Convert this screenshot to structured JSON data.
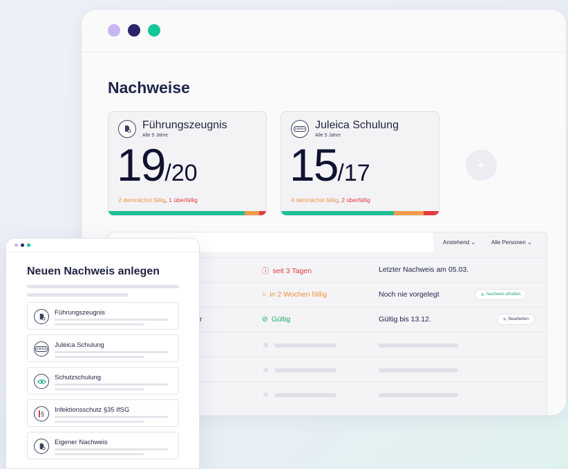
{
  "app": {
    "page_title": "Nachweise"
  },
  "cards": [
    {
      "title": "Führungszeugnis",
      "subtitle": "Alle 5 Jahre",
      "count": "19",
      "total": "/20",
      "status_soon": "2 demnächst fällig",
      "status_sep": ", ",
      "status_overdue": "1 überfällig",
      "progress": {
        "ok": 19,
        "soon": 2,
        "overdue": 1
      }
    },
    {
      "title": "Juleica Schulung",
      "subtitle": "Alle 5 Jahre",
      "count": "15",
      "total": "/17",
      "icon_text": "juleica",
      "status_soon": "4 demnächst fällig",
      "status_sep": ", ",
      "status_overdue": "2 überfällig",
      "progress": {
        "ok": 15,
        "soon": 4,
        "overdue": 2
      }
    }
  ],
  "add_button": {
    "label": "+"
  },
  "table": {
    "filters": [
      "Anstehend ⌄",
      "Alle Personen ⌄"
    ],
    "rows": [
      {
        "status": "seit 3 Tagen",
        "status_icon": "ⓘ",
        "info": "Letzter Nachweis am 05.03."
      },
      {
        "status": "in 2 Wochen fällig",
        "status_icon": "○",
        "info": "Noch nie vorgelegt",
        "badge": "Nachweis erhalten",
        "badge_icon": "⊘"
      },
      {
        "name_fragment": "r",
        "status": "Gültig",
        "status_icon": "⊘",
        "info": "Gültig bis 13.12.",
        "badge": "Bearbeiten",
        "badge_icon": "✎"
      }
    ]
  },
  "dialog": {
    "title": "Neuen Nachweis anlegen",
    "items": [
      {
        "label": "Führungszeugnis",
        "icon": "document-icon"
      },
      {
        "label": "Juleica Schulung",
        "icon": "juleica-icon",
        "icon_text": "juleica"
      },
      {
        "label": "Schutzschulung",
        "icon": "eye-icon"
      },
      {
        "label": "Infektionsschutz §35 IfSG",
        "icon": "paragraph-icon",
        "icon_text": "§"
      },
      {
        "label": "Eigener Nachweis",
        "icon": "document-icon"
      }
    ]
  },
  "colors": {
    "green": "#1dbf91",
    "orange": "#f29a4c",
    "red": "#e33b3b",
    "navy": "#2a2468",
    "lavender": "#c8b6f3"
  }
}
